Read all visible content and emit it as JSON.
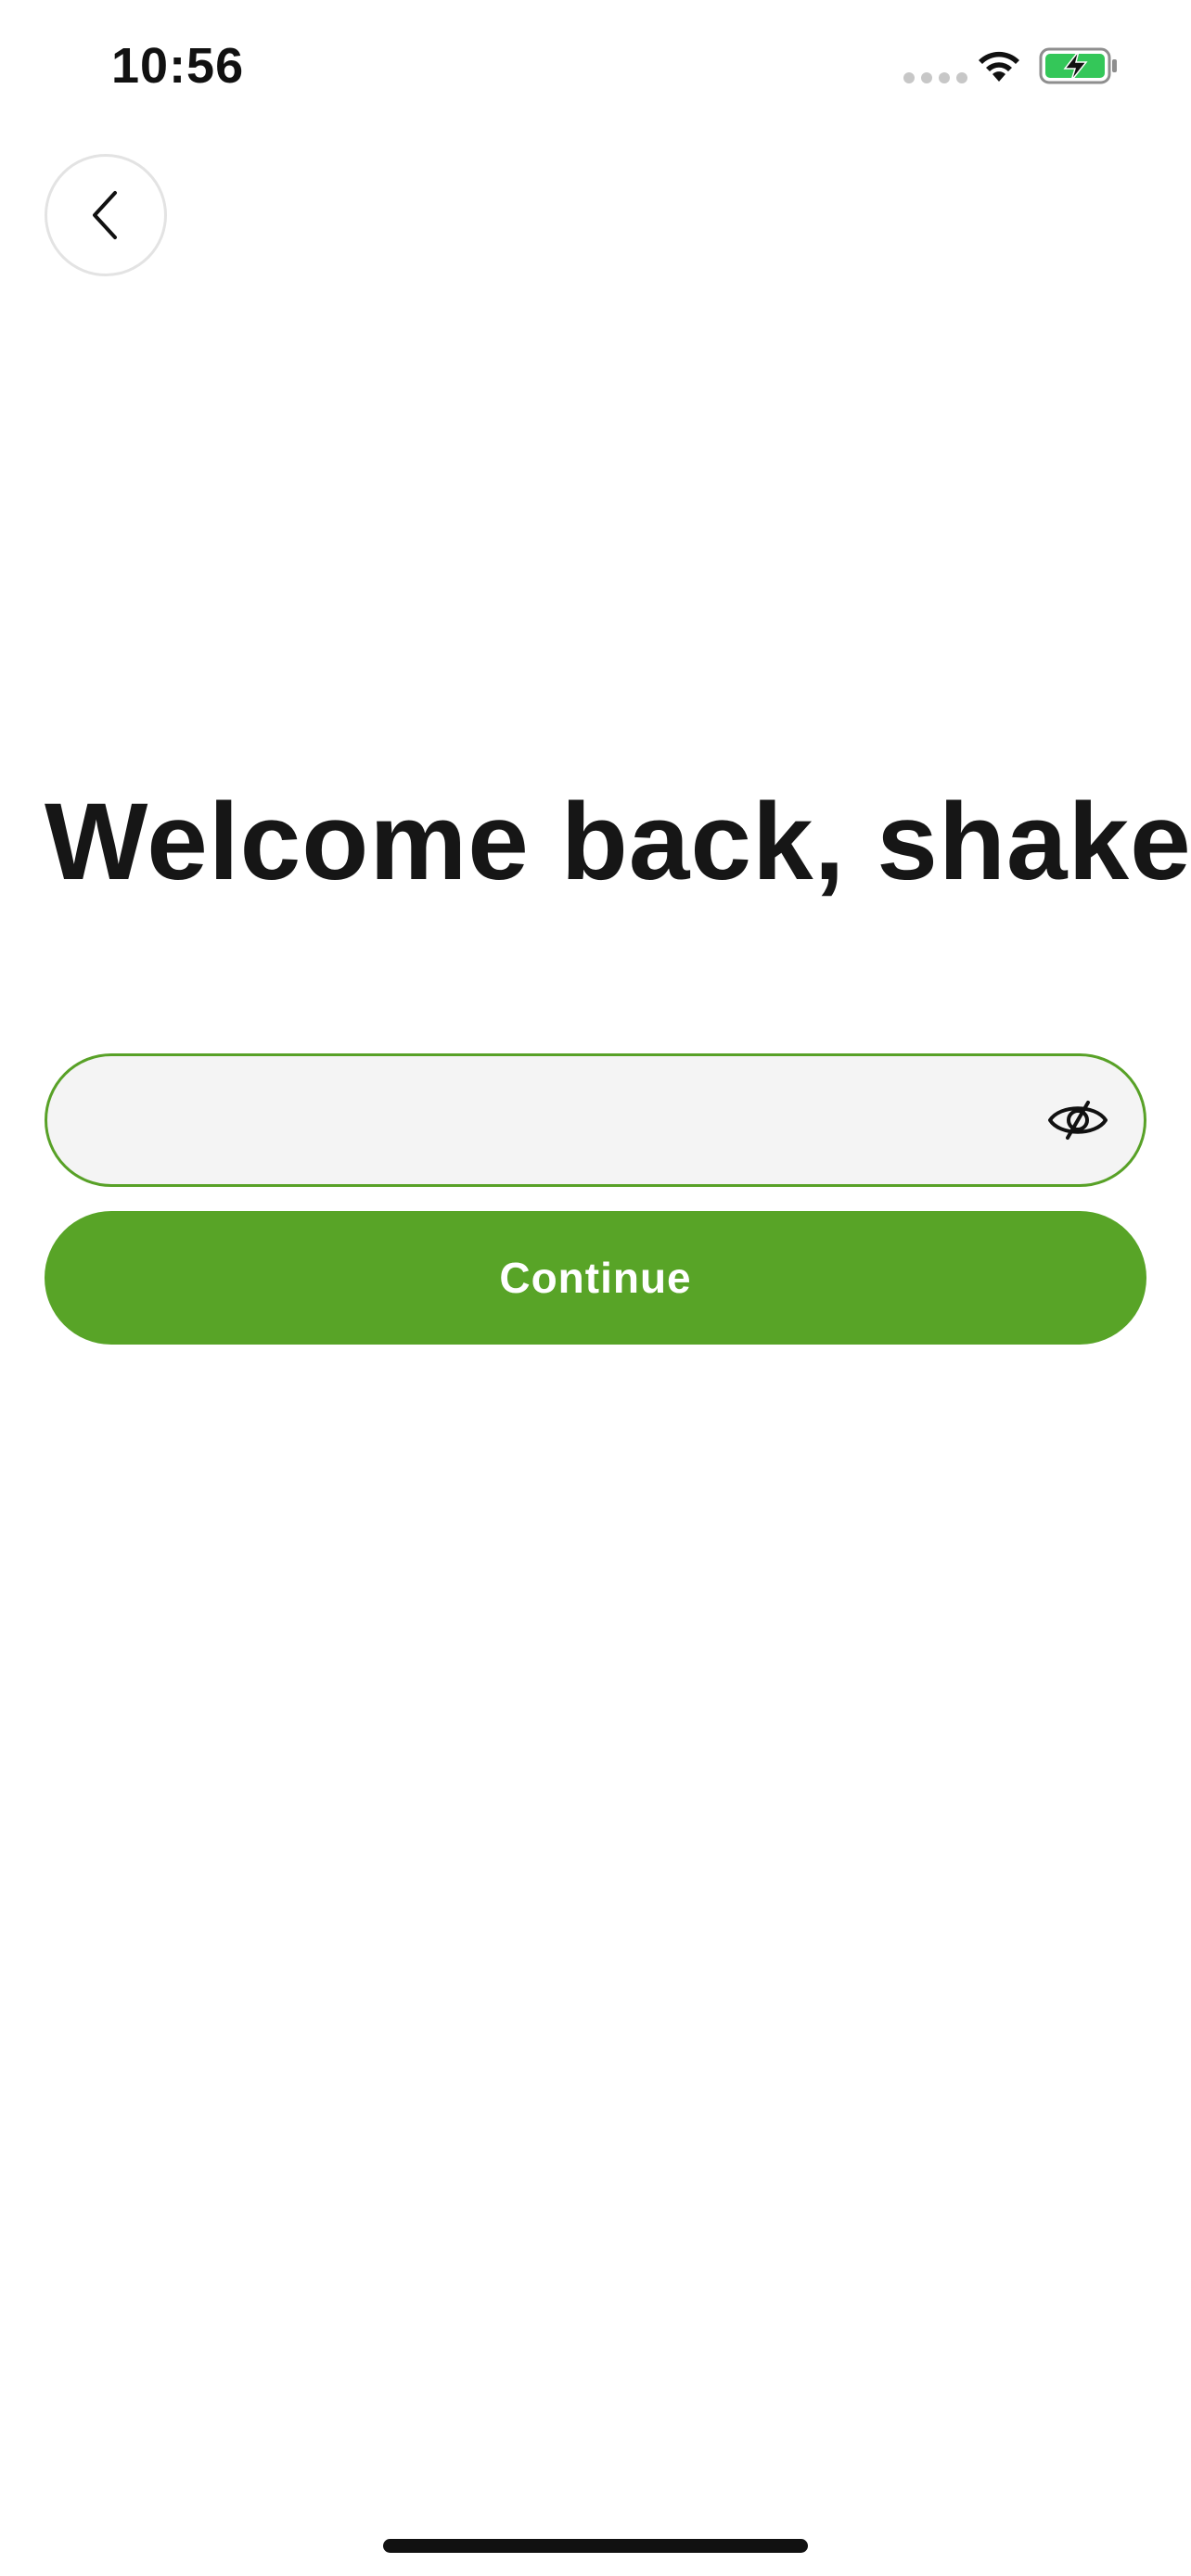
{
  "status_bar": {
    "time": "10:56"
  },
  "icons": {
    "back": "chevron-left-icon",
    "visibility": "eye-slash-icon",
    "wifi": "wifi-icon",
    "battery": "battery-charging-icon"
  },
  "header": {
    "title": "Welcome back, shake!"
  },
  "form": {
    "password_value": "",
    "password_placeholder": "",
    "continue_label": "Continue"
  },
  "colors": {
    "accent": "#58a427",
    "field_border": "#58a127",
    "field_background": "#f4f4f4",
    "battery_fill": "#34c759",
    "text": "#161616"
  }
}
